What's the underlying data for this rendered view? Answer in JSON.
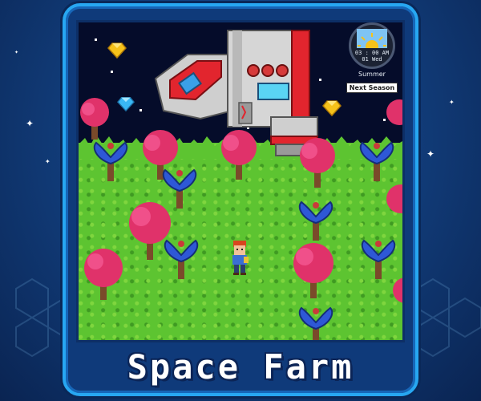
{
  "game": {
    "title": "Space Farm"
  },
  "hud": {
    "clock": {
      "time": "03 : 00 AM",
      "day": "01 Wed",
      "season": "Summer",
      "next_season_label": "Next Season"
    }
  },
  "colors": {
    "background": "#123f7e",
    "frame_border": "#27a7f2",
    "grass": "#5dc431",
    "sky": "#050c2a",
    "pink_tree": "#e0326a",
    "blue_flower": "#2e58d6",
    "ship_red": "#e2252e",
    "ship_grey": "#c9c9c9",
    "title_text": "#ffffff"
  },
  "icons": {
    "gems": [
      "yellow-diamond-icon",
      "blue-diamond-icon",
      "yellow-diamond-icon"
    ],
    "clock": "sun-clock-icon"
  }
}
